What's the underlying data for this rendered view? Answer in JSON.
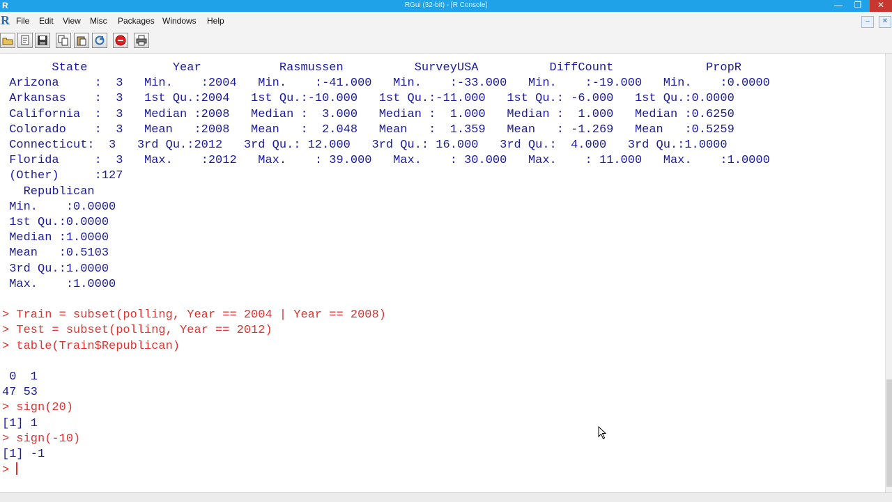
{
  "window": {
    "title": "RGui (32-bit) - [R Console]",
    "controls": {
      "minimize": "—",
      "maximize": "❐",
      "close": "✕"
    },
    "mdi_controls": {
      "minimize": "–",
      "restore": "❐",
      "close": "✕"
    }
  },
  "menubar": {
    "items": [
      "File",
      "Edit",
      "View",
      "Misc",
      "Packages",
      "Windows",
      "Help"
    ]
  },
  "toolbar": {
    "buttons": [
      "open-script-icon",
      "load-workspace-icon",
      "save-icon",
      "copy-icon",
      "paste-icon",
      "copy-paste-icon",
      "stop-icon",
      "print-icon"
    ]
  },
  "console": {
    "lines": [
      {
        "text": "       State            Year           Rasmussen          SurveyUSA          DiffCount             PropR",
        "kind": "output"
      },
      {
        "text": " Arizona     :  3   Min.    :2004   Min.    :-41.000   Min.    :-33.000   Min.    :-19.000   Min.    :0.0000",
        "kind": "output"
      },
      {
        "text": " Arkansas    :  3   1st Qu.:2004   1st Qu.:-10.000   1st Qu.:-11.000   1st Qu.: -6.000   1st Qu.:0.0000",
        "kind": "output"
      },
      {
        "text": " California  :  3   Median :2008   Median :  3.000   Median :  1.000   Median :  1.000   Median :0.6250",
        "kind": "output"
      },
      {
        "text": " Colorado    :  3   Mean   :2008   Mean   :  2.048   Mean   :  1.359   Mean   : -1.269   Mean   :0.5259",
        "kind": "output"
      },
      {
        "text": " Connecticut:  3   3rd Qu.:2012   3rd Qu.: 12.000   3rd Qu.: 16.000   3rd Qu.:  4.000   3rd Qu.:1.0000",
        "kind": "output"
      },
      {
        "text": " Florida     :  3   Max.    :2012   Max.    : 39.000   Max.    : 30.000   Max.    : 11.000   Max.    :1.0000",
        "kind": "output"
      },
      {
        "text": " (Other)     :127",
        "kind": "output"
      },
      {
        "text": "   Republican",
        "kind": "output"
      },
      {
        "text": " Min.    :0.0000",
        "kind": "output"
      },
      {
        "text": " 1st Qu.:0.0000",
        "kind": "output"
      },
      {
        "text": " Median :1.0000",
        "kind": "output"
      },
      {
        "text": " Mean   :0.5103",
        "kind": "output"
      },
      {
        "text": " 3rd Qu.:1.0000",
        "kind": "output"
      },
      {
        "text": " Max.    :1.0000",
        "kind": "output"
      },
      {
        "text": "",
        "kind": "output"
      },
      {
        "text": "> Train = subset(polling, Year == 2004 | Year == 2008)",
        "kind": "cmd"
      },
      {
        "text": "> Test = subset(polling, Year == 2012)",
        "kind": "cmd"
      },
      {
        "text": "> table(Train$Republican)",
        "kind": "cmd"
      },
      {
        "text": "",
        "kind": "output"
      },
      {
        "text": " 0  1",
        "kind": "output"
      },
      {
        "text": "47 53",
        "kind": "output"
      },
      {
        "text": "> sign(20)",
        "kind": "cmd"
      },
      {
        "text": "[1] 1",
        "kind": "output"
      },
      {
        "text": "> sign(-10)",
        "kind": "cmd"
      },
      {
        "text": "[1] -1",
        "kind": "output"
      }
    ],
    "prompt": "> "
  }
}
